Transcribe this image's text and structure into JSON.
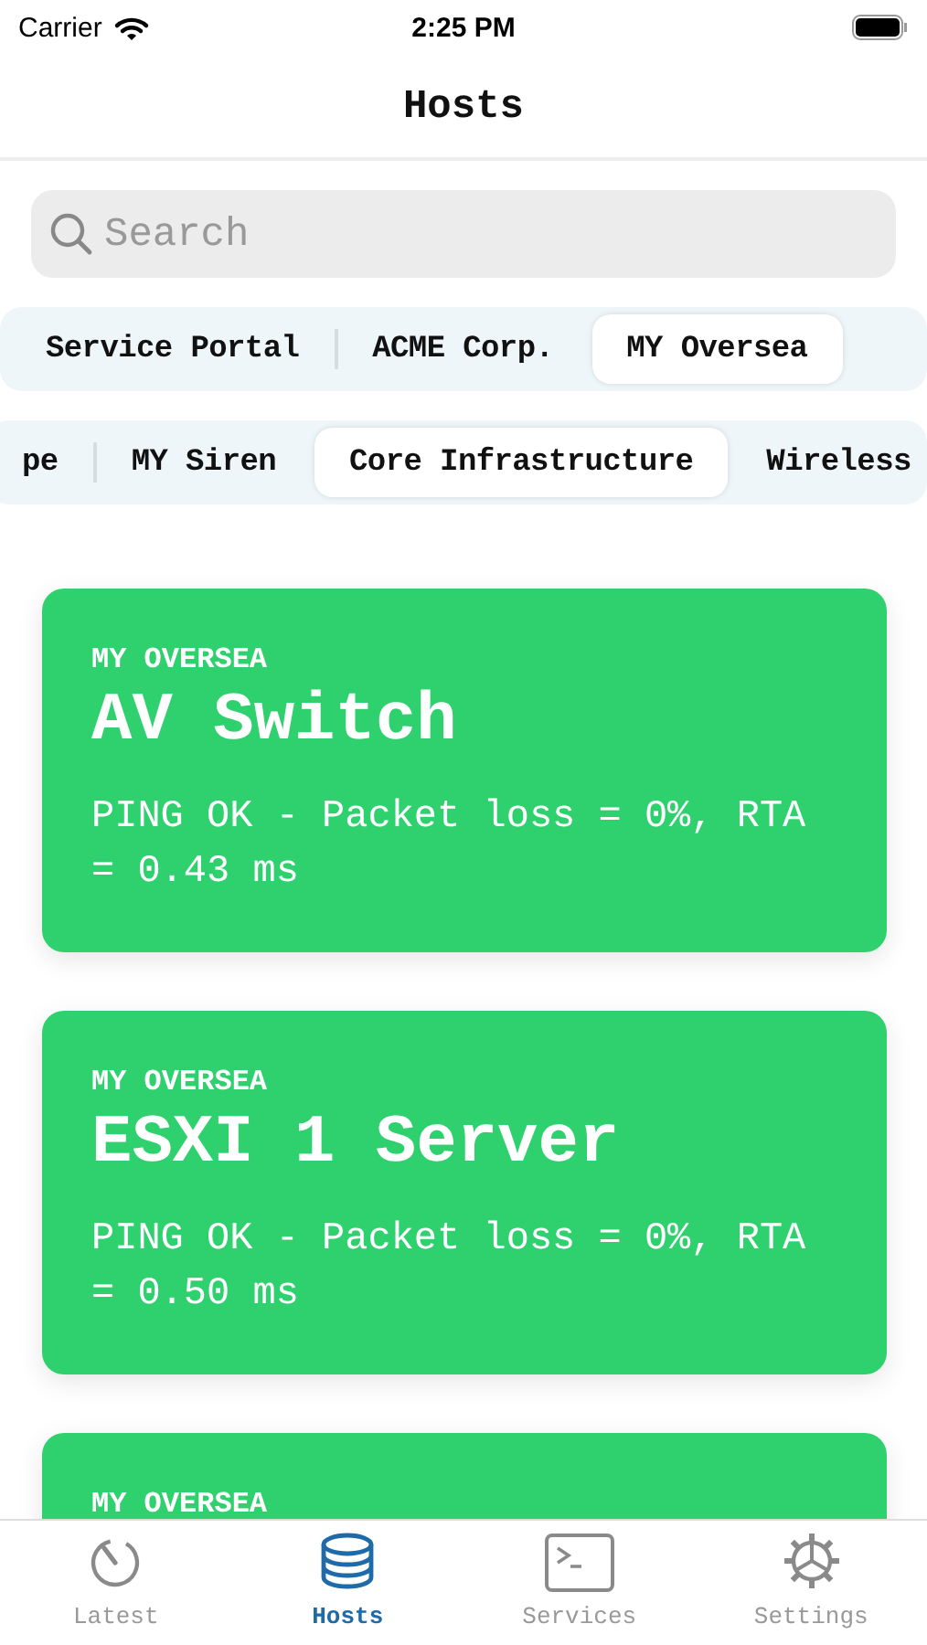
{
  "status_bar": {
    "carrier": "Carrier",
    "time": "2:25 PM"
  },
  "navigation": {
    "title": "Hosts"
  },
  "search": {
    "placeholder": "Search"
  },
  "filter_rows": [
    {
      "items": [
        {
          "label": "Service Portal",
          "selected": false
        },
        {
          "label": "ACME Corp.",
          "selected": false
        },
        {
          "label": "MY Oversea",
          "selected": true
        }
      ]
    },
    {
      "items": [
        {
          "label": "pe",
          "selected": false
        },
        {
          "label": "MY Siren",
          "selected": false
        },
        {
          "label": "Core Infrastructure",
          "selected": true
        },
        {
          "label": "Wireless",
          "selected": false
        }
      ]
    }
  ],
  "hosts": [
    {
      "category": "MY OVERSEA",
      "title": "AV Switch",
      "message": "PING OK - Packet loss = 0%, RTA = 0.43 ms",
      "color": "#2fd16f"
    },
    {
      "category": "MY OVERSEA",
      "title": "ESXI 1 Server",
      "message": "PING OK - Packet loss = 0%, RTA = 0.50 ms",
      "color": "#2fd16f"
    },
    {
      "category": "MY OVERSEA",
      "color": "#2fd16f"
    }
  ],
  "tab_bar": [
    {
      "label": "Latest",
      "kind": "timer",
      "selected": false
    },
    {
      "label": "Hosts",
      "kind": "database",
      "selected": true
    },
    {
      "label": "Services",
      "kind": "terminal",
      "selected": false
    },
    {
      "label": "Settings",
      "kind": "gear",
      "selected": false
    }
  ]
}
